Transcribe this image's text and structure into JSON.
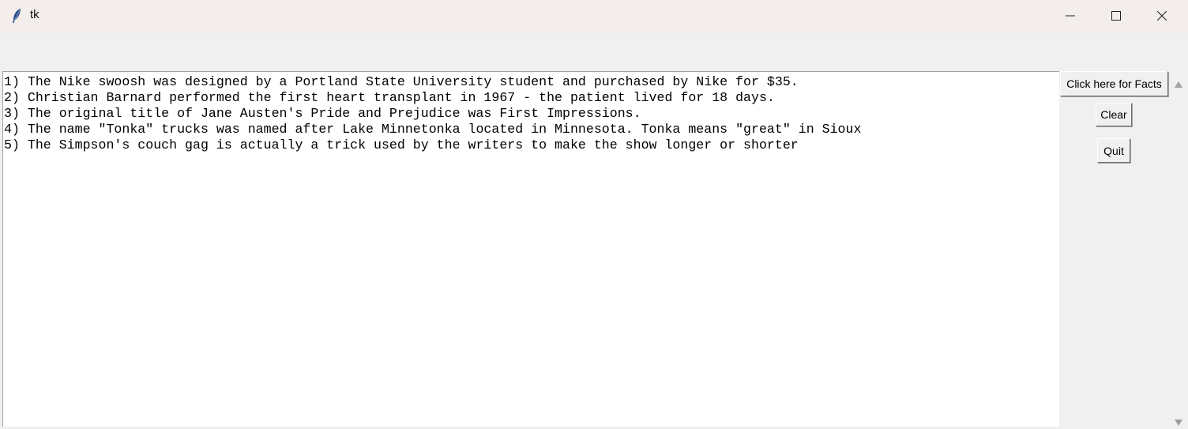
{
  "window": {
    "title": "tk",
    "icon": "feather-icon",
    "controls": [
      "minimize-icon",
      "maximize-icon",
      "close-icon"
    ]
  },
  "text_area": {
    "lines": [
      "1) The Nike swoosh was designed by a Portland State University student and purchased by Nike for $35.",
      "2) Christian Barnard performed the first heart transplant in 1967 - the patient lived for 18 days.",
      "3) The original title of Jane Austen's Pride and Prejudice was First Impressions.",
      "4) The name \"Tonka\" trucks was named after Lake Minnetonka located in Minnesota. Tonka means \"great\" in Sioux",
      "5) The Simpson's couch gag is actually a trick used by the writers to make the show longer or shorter"
    ]
  },
  "buttons": {
    "facts": "Click here for Facts",
    "clear": "Clear",
    "quit": "Quit"
  },
  "scrollbar": {
    "up_icon": "scroll-up-arrow-icon",
    "down_icon": "scroll-down-arrow-icon"
  }
}
